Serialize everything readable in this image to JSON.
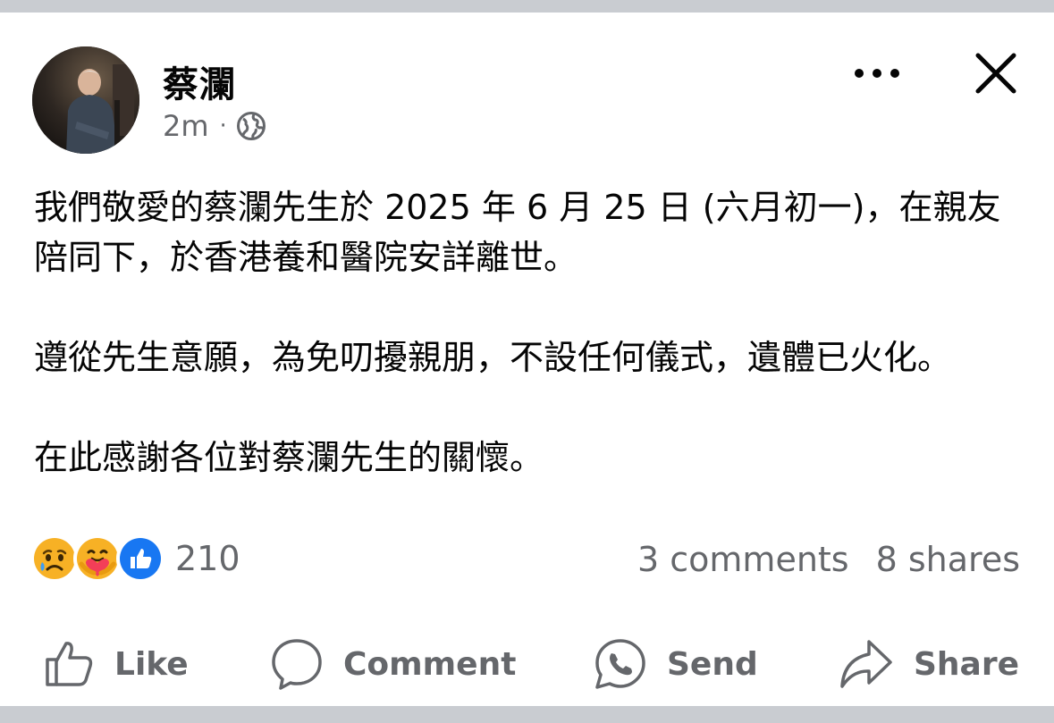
{
  "post": {
    "author": "蔡瀾",
    "time": "2m",
    "separator": "·",
    "privacy_icon": "globe-icon",
    "paragraphs": [
      "我們敬愛的蔡瀾先生於 2025 年 6 月 25 日 (六月初一)，在親友陪同下，於香港養和醫院安詳離世。",
      "遵從先生意願，為免叨擾親朋，不設任何儀式，遺體已火化。",
      "在此感謝各位對蔡瀾先生的關懷。"
    ]
  },
  "header_actions": {
    "more_icon": "more-options-icon",
    "close_icon": "close-icon"
  },
  "stats": {
    "reaction_icons": [
      "sad-reaction-icon",
      "care-reaction-icon",
      "like-reaction-icon"
    ],
    "reaction_count": "210",
    "comments": "3 comments",
    "shares": "8 shares"
  },
  "actions": {
    "like": "Like",
    "comment": "Comment",
    "send": "Send",
    "share": "Share"
  },
  "colors": {
    "text": "#050505",
    "secondary": "#65676b",
    "like_blue": "#1877f2",
    "reaction_yellow": "#f7b125",
    "care_red": "#f33e58"
  }
}
